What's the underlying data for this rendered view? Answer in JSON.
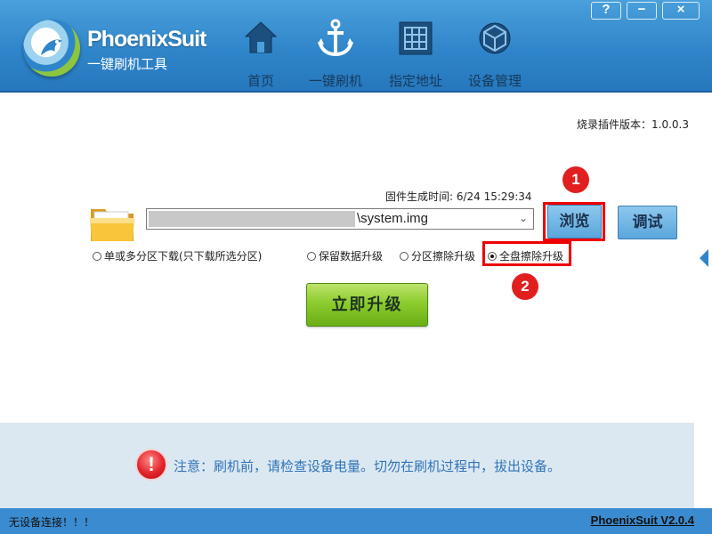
{
  "app": {
    "name": "PhoenixSuit",
    "subtitle": "一键刷机工具"
  },
  "window_controls": [
    "?",
    "−",
    "×"
  ],
  "nav": [
    {
      "label": "首页",
      "icon": "home-icon"
    },
    {
      "label": "一键刷机",
      "icon": "anchor-icon"
    },
    {
      "label": "指定地址",
      "icon": "grid-icon"
    },
    {
      "label": "设备管理",
      "icon": "cube-icon"
    }
  ],
  "main": {
    "plugin_version": "烧录插件版本：1.0.0.3",
    "firmware_time": "固件生成时间:  6/24 15:29:34",
    "path_value": "\\system.img",
    "browse_label": "浏览",
    "debug_label": "调试",
    "options": [
      {
        "label": "单或多分区下载(只下载所选分区)",
        "checked": false
      },
      {
        "label": "保留数据升级",
        "checked": false
      },
      {
        "label": "分区擦除升级",
        "checked": false
      },
      {
        "label": "全盘擦除升级",
        "checked": true
      }
    ],
    "upgrade_label": "立即升级",
    "markers": [
      "1",
      "2"
    ]
  },
  "notice": {
    "icon": "!",
    "text": "注意：刷机前，请检查设备电量。切勿在刷机过程中，拔出设备。"
  },
  "status": {
    "left": "无设备连接！！！",
    "right": "PhoenixSuit V2.0.4"
  },
  "colors": {
    "header_blue": "#2f85c9",
    "highlight_red": "#e00000",
    "upgrade_green": "#8ccc2d",
    "notice_text": "#3073b8"
  }
}
